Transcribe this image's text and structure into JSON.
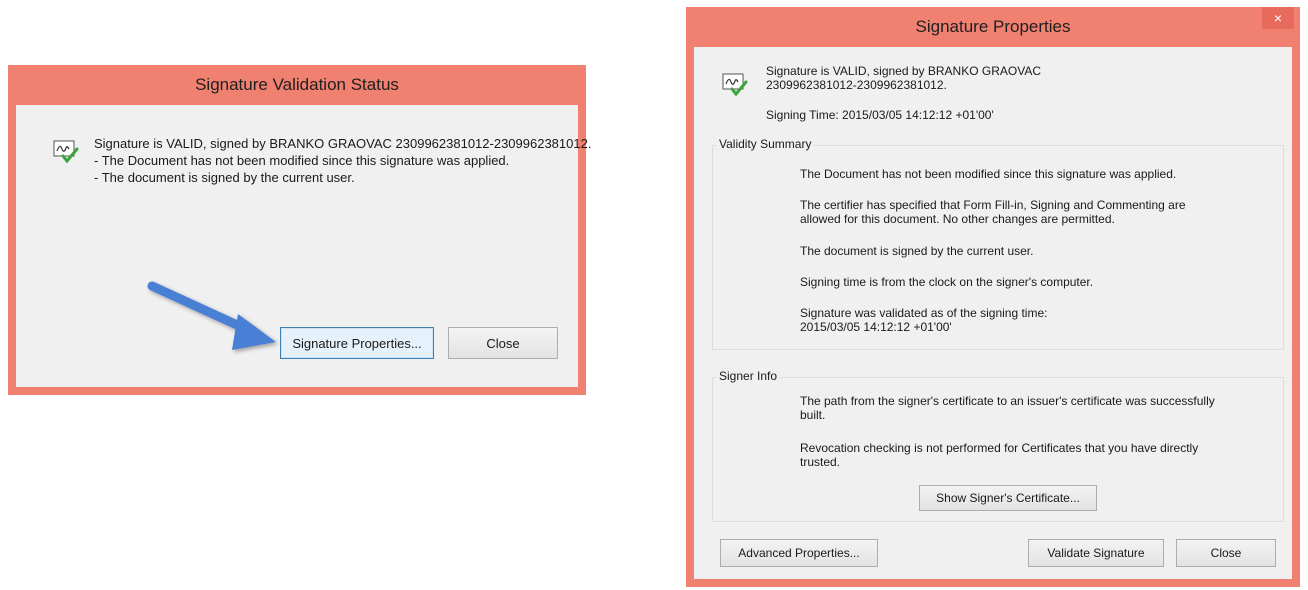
{
  "validation_dialog": {
    "title": "Signature Validation Status",
    "line1": "Signature is VALID, signed by BRANKO GRAOVAC 2309962381012-2309962381012.",
    "line2": "- The Document has not been modified since this signature was applied.",
    "line3": "- The document is signed by the current user.",
    "properties_button": "Signature Properties...",
    "close_button": "Close",
    "icon": "signature-valid-icon"
  },
  "properties_dialog": {
    "title": "Signature Properties",
    "close_glyph": "×",
    "header_line1": "Signature is VALID, signed by BRANKO GRAOVAC",
    "header_line2": "2309962381012-2309962381012.",
    "signing_time": "Signing Time:  2015/03/05 14:12:12 +01'00'",
    "validity_summary": {
      "label": "Validity Summary",
      "item1": "The Document has not been modified since this signature was applied.",
      "item2a": "The certifier has specified that Form Fill-in, Signing and Commenting are",
      "item2b": "allowed for this document. No other changes are permitted.",
      "item3": "The document is signed by the current user.",
      "item4": "Signing time is from the clock on the signer's computer.",
      "item5a": "Signature was validated as of the signing time:",
      "item5b": "2015/03/05 14:12:12 +01'00'"
    },
    "signer_info": {
      "label": "Signer Info",
      "item1a": "The path from the signer's certificate to an issuer's certificate was successfully",
      "item1b": "built.",
      "item2a": "Revocation checking is not performed for Certificates that you have directly",
      "item2b": "trusted.",
      "show_cert_button": "Show Signer's Certificate..."
    },
    "advanced_button": "Advanced Properties...",
    "validate_button": "Validate Signature",
    "close_button": "Close"
  },
  "colors": {
    "frame": "#f08070",
    "body": "#f0f0f0",
    "arrow": "#4a7fd4"
  }
}
